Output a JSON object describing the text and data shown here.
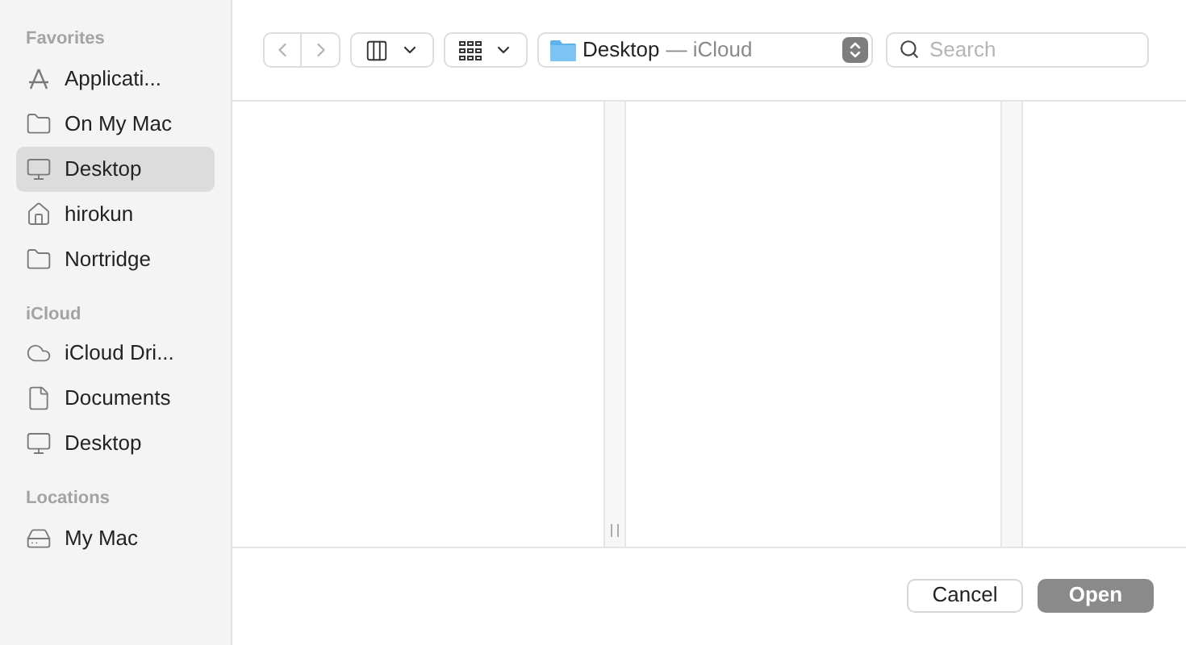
{
  "sidebar": {
    "sections": [
      {
        "title": "Favorites",
        "items": [
          {
            "label": "Applicati...",
            "kind": "apps",
            "selected": false
          },
          {
            "label": "On My Mac",
            "kind": "folder",
            "selected": false
          },
          {
            "label": "Desktop",
            "kind": "desktop",
            "selected": true
          },
          {
            "label": "hirokun",
            "kind": "home",
            "selected": false
          },
          {
            "label": "Nortridge",
            "kind": "folder",
            "selected": false
          }
        ]
      },
      {
        "title": "iCloud",
        "items": [
          {
            "label": "iCloud Dri...",
            "kind": "cloud",
            "selected": false
          },
          {
            "label": "Documents",
            "kind": "document",
            "selected": false
          },
          {
            "label": "Desktop",
            "kind": "desktop",
            "selected": false
          }
        ]
      },
      {
        "title": "Locations",
        "items": [
          {
            "label": "My Mac",
            "kind": "drive",
            "selected": false
          }
        ]
      }
    ]
  },
  "toolbar": {
    "location": {
      "name": "Desktop",
      "suffix": "— iCloud"
    },
    "search": {
      "placeholder": "Search"
    }
  },
  "buttons": [
    {
      "label": "Cancel",
      "kind": "default",
      "disabled": false
    },
    {
      "label": "Open",
      "kind": "primary",
      "disabled": true
    }
  ]
}
